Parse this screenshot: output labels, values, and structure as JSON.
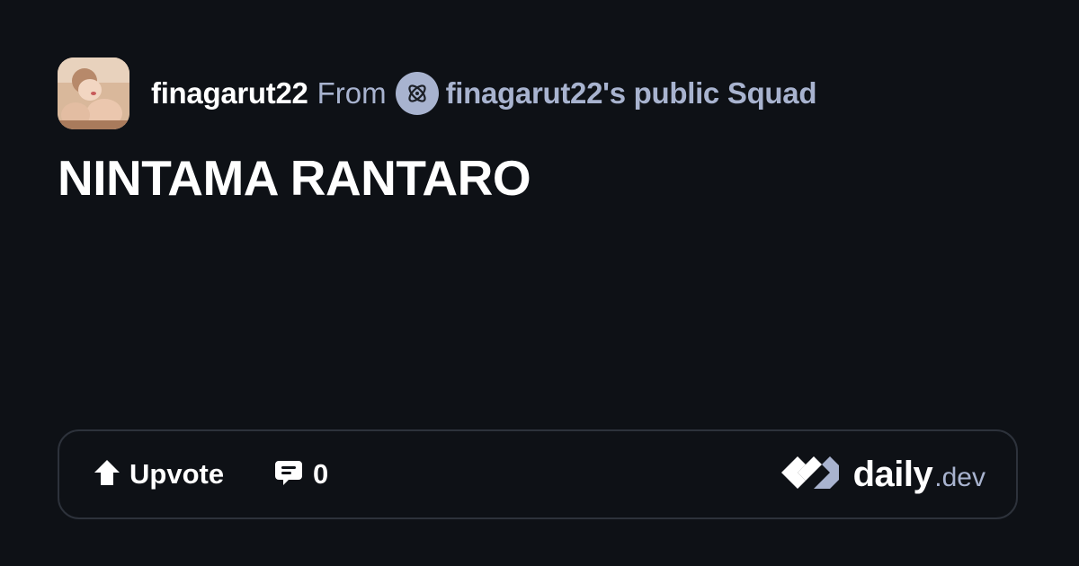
{
  "post": {
    "author": "finagarut22",
    "from_label": "From",
    "squad_name": "finagarut22's public Squad",
    "title": "NINTAMA RANTARO"
  },
  "actions": {
    "upvote_label": "Upvote",
    "comment_count": "0"
  },
  "brand": {
    "name": "daily",
    "suffix": ".dev"
  },
  "icons": {
    "avatar": "author-avatar",
    "squad": "squad-icon",
    "upvote": "upvote-arrow-icon",
    "comment": "comment-bubble-icon",
    "logo": "daily-dev-logo-icon"
  },
  "colors": {
    "background": "#0e1116",
    "text_primary": "#ffffff",
    "text_secondary": "#a8b3cf",
    "border": "#2d323b"
  }
}
